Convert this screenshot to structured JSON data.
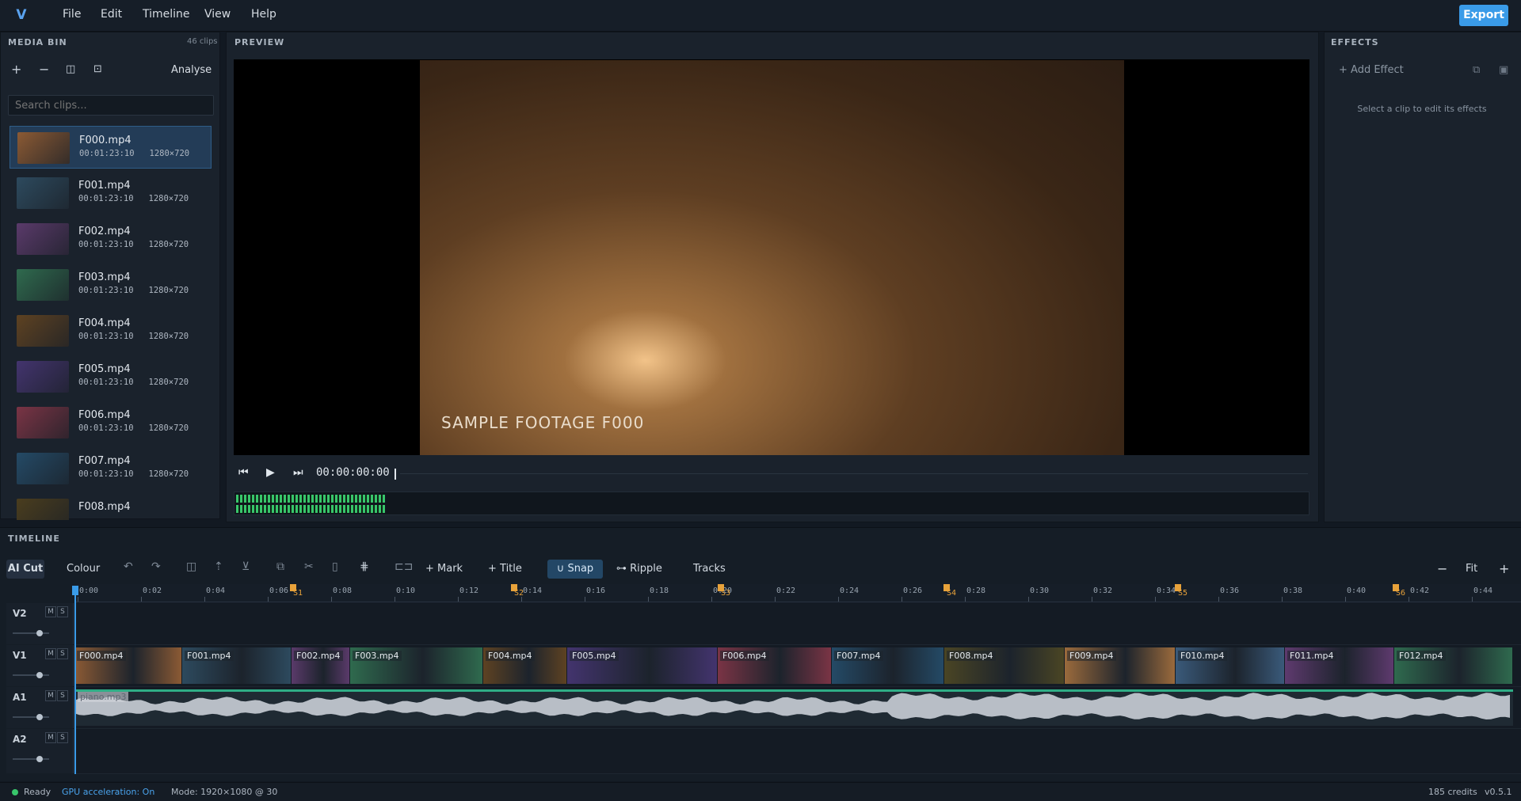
{
  "app": {
    "logo": "V"
  },
  "menu": [
    "File",
    "Edit",
    "Timeline",
    "View",
    "Help"
  ],
  "export_label": "Export",
  "media_bin": {
    "title": "MEDIA BIN",
    "count": "46 clips",
    "analyse_label": "Analyse",
    "search_placeholder": "Search clips...",
    "clips": [
      {
        "name": "F000.mp4",
        "duration": "00:01:23:10",
        "res": "1280×720",
        "color": "#8b5a34"
      },
      {
        "name": "F001.mp4",
        "duration": "00:01:23:10",
        "res": "1280×720",
        "color": "#2d4a5e"
      },
      {
        "name": "F002.mp4",
        "duration": "00:01:23:10",
        "res": "1280×720",
        "color": "#5a3a6a"
      },
      {
        "name": "F003.mp4",
        "duration": "00:01:23:10",
        "res": "1280×720",
        "color": "#2f6a4e"
      },
      {
        "name": "F004.mp4",
        "duration": "00:01:23:10",
        "res": "1280×720",
        "color": "#5e4222"
      },
      {
        "name": "F005.mp4",
        "duration": "00:01:23:10",
        "res": "1280×720",
        "color": "#43346e"
      },
      {
        "name": "F006.mp4",
        "duration": "00:01:23:10",
        "res": "1280×720",
        "color": "#7a3445"
      },
      {
        "name": "F007.mp4",
        "duration": "00:01:23:10",
        "res": "1280×720",
        "color": "#244a66"
      },
      {
        "name": "F008.mp4",
        "duration": "",
        "res": "",
        "color": "#4a3d1e"
      }
    ]
  },
  "preview": {
    "title": "PREVIEW",
    "overlay_text": "SAMPLE FOOTAGE  F000",
    "timecode": "00:00:00:00"
  },
  "effects": {
    "title": "EFFECTS",
    "add_label": "Add Effect",
    "empty_text": "Select a clip to edit its effects"
  },
  "timeline": {
    "title": "TIMELINE",
    "ai_cut": "AI Cut",
    "colour": "Colour",
    "mark": "Mark",
    "title_btn": "Title",
    "snap": "Snap",
    "ripple": "Ripple",
    "tracks": "Tracks",
    "fit": "Fit",
    "ruler": [
      "0:00",
      "0:02",
      "0:04",
      "0:06",
      "0:08",
      "0:10",
      "0:12",
      "0:14",
      "0:16",
      "0:18",
      "0:20",
      "0:22",
      "0:24",
      "0:26",
      "0:28",
      "0:30",
      "0:32",
      "0:34",
      "0:36",
      "0:38",
      "0:40",
      "0:42",
      "0:44"
    ],
    "markers": [
      "S1",
      "S2",
      "S3",
      "S4",
      "S5",
      "S6"
    ],
    "track_names": [
      "V2",
      "V1",
      "A1",
      "A2"
    ],
    "mute": "M",
    "solo": "S",
    "v1_clips": [
      {
        "name": "F000.mp4",
        "color": "#8b5a34"
      },
      {
        "name": "F001.mp4",
        "color": "#2d4a5e"
      },
      {
        "name": "F002.mp4",
        "color": "#5a3a6a"
      },
      {
        "name": "F003.mp4",
        "color": "#2f6a4e"
      },
      {
        "name": "F004.mp4",
        "color": "#5e4222"
      },
      {
        "name": "F005.mp4",
        "color": "#43346e"
      },
      {
        "name": "F006.mp4",
        "color": "#7a3445"
      },
      {
        "name": "F007.mp4",
        "color": "#244a66"
      },
      {
        "name": "F008.mp4",
        "color": "#4a4524"
      },
      {
        "name": "F009.mp4",
        "color": "#9a6a3c"
      },
      {
        "name": "F010.mp4",
        "color": "#3a5a7a"
      },
      {
        "name": "F011.mp4",
        "color": "#5e3a6e"
      },
      {
        "name": "F012.mp4",
        "color": "#2f6a4e"
      }
    ],
    "audio_clip": "piano.mp3"
  },
  "status": {
    "ready": "Ready",
    "gpu": "GPU acceleration: On",
    "mode": "Mode: 1920×1080 @ 30",
    "credits": "185 credits",
    "version": "v0.5.1"
  },
  "colors": {
    "accent": "#3a9be8",
    "marker": "#e8a23a",
    "meter": "#38c66b"
  }
}
